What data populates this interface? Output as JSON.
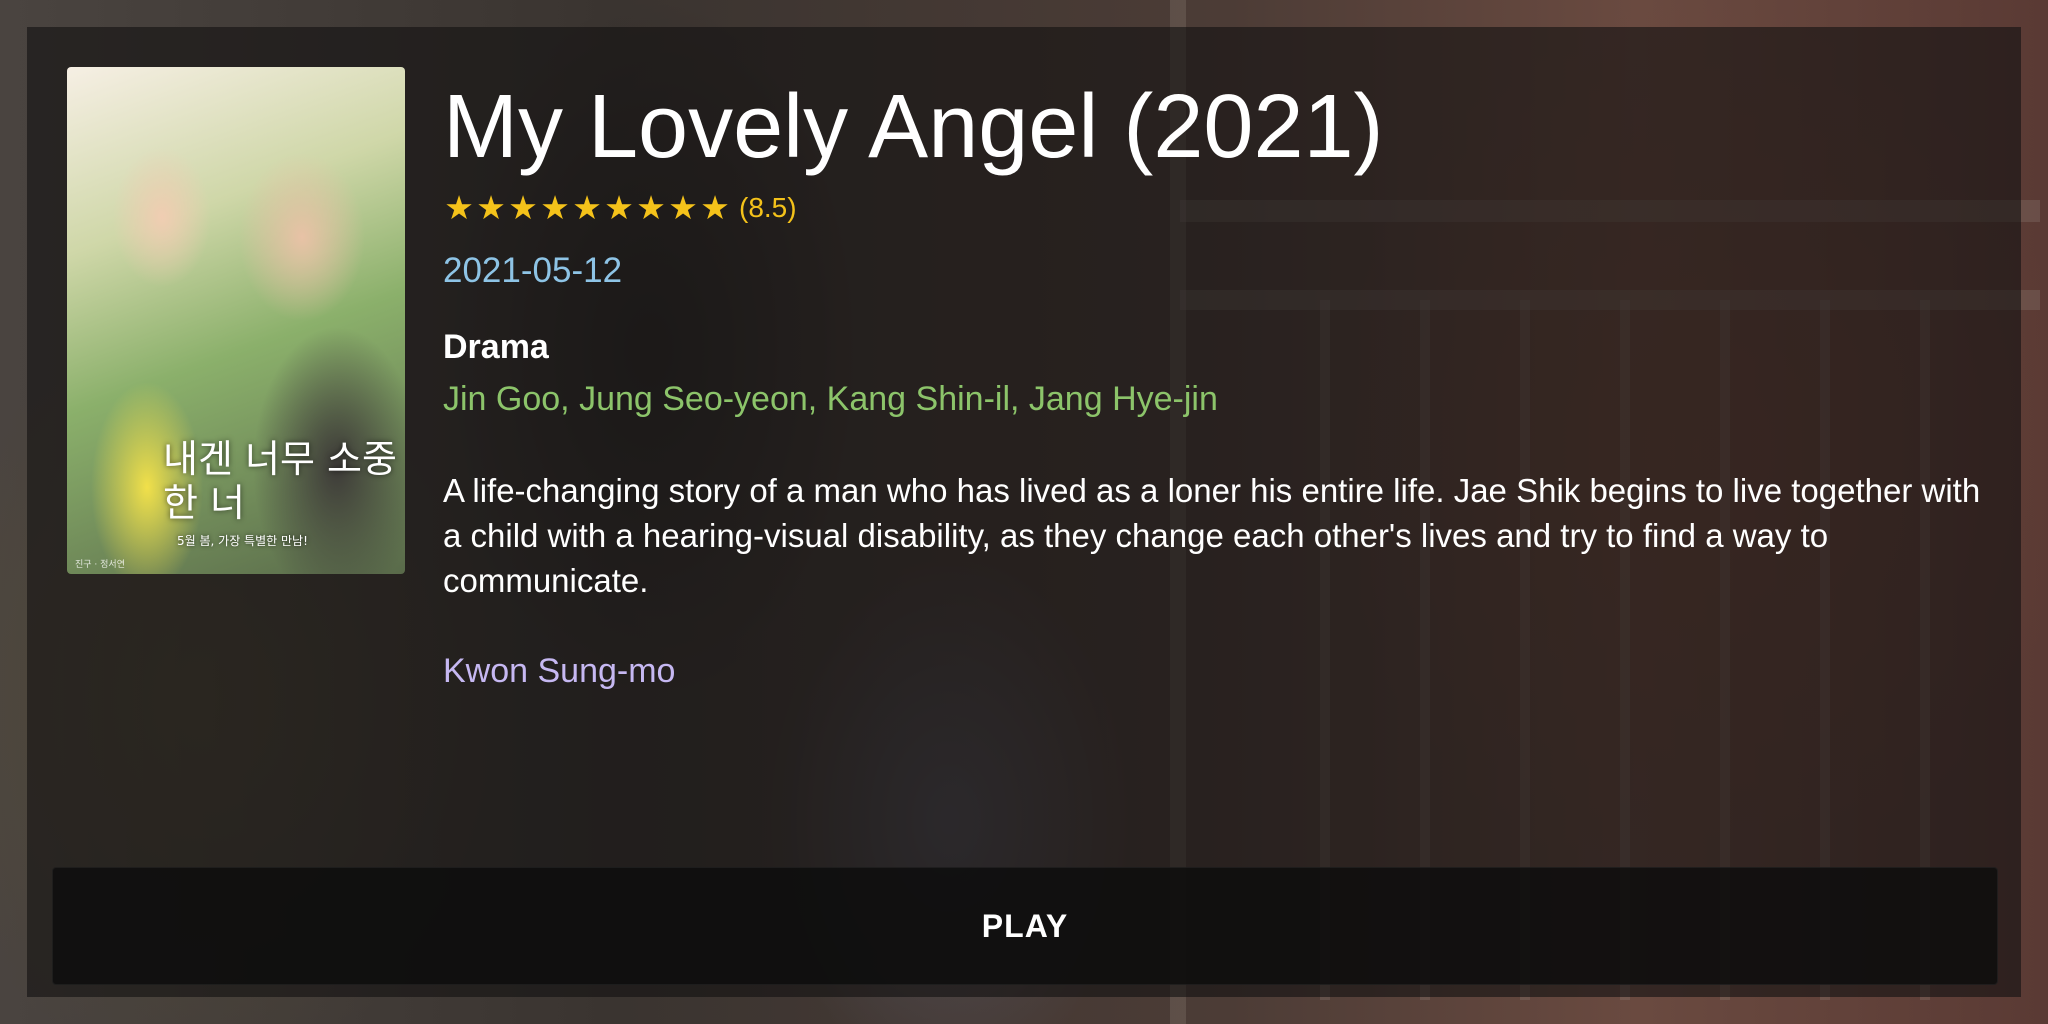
{
  "movie": {
    "title": "My Lovely Angel (2021)",
    "rating_stars": 9,
    "rating_value": "(8.5)",
    "release_date": "2021-05-12",
    "genre": "Drama",
    "cast": "Jin Goo, Jung Seo-yeon, Kang Shin-il, Jang Hye-jin",
    "overview": "A life-changing story of a man who has lived as a loner his entire life. Jae Shik begins to live together with a child with a hearing-visual disability, as they change each other's lives and try to find a way to communicate.",
    "director": "Kwon Sung-mo"
  },
  "poster": {
    "title": "내겐 너무 소중한 너",
    "tagline": "5월 봄, 가장 특별한 만남!",
    "credit": "진구 · 정서연"
  },
  "actions": {
    "play_label": "PLAY"
  },
  "colors": {
    "star": "#f4c21a",
    "date": "#8ec4e6",
    "cast": "#8cc46a",
    "director": "#c6b8f2"
  },
  "icons": {
    "star": "star-icon"
  }
}
